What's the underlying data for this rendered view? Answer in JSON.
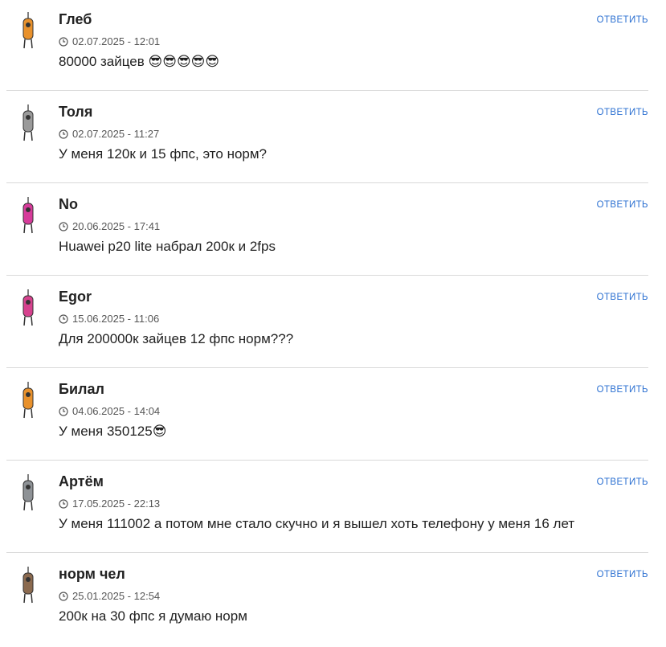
{
  "reply_label": "ОТВЕТИТЬ",
  "comments": [
    {
      "author": "Глеб",
      "date": "02.07.2025 - 12:01",
      "text": "80000 зайцев 😎😎😎😎😎",
      "avatar_color": "#e8912c"
    },
    {
      "author": "Толя",
      "date": "02.07.2025 - 11:27",
      "text": "У меня 120к и 15 фпс, это норм?",
      "avatar_color": "#9a9a9a"
    },
    {
      "author": "No",
      "date": "20.06.2025 - 17:41",
      "text": "Huawei p20 lite набрал 200к и 2fps",
      "avatar_color": "#d63b9a"
    },
    {
      "author": "Egor",
      "date": "15.06.2025 - 11:06",
      "text": "Для 200000к зайцев 12 фпс норм???",
      "avatar_color": "#d6428e"
    },
    {
      "author": "Билал",
      "date": "04.06.2025 - 14:04",
      "text": "У меня 350125😎",
      "avatar_color": "#e8912c"
    },
    {
      "author": "Артём",
      "date": "17.05.2025 - 22:13",
      "text": "У меня 111002 а потом мне стало скучно и я вышел хоть телефону у меня 16 лет",
      "avatar_color": "#8e9296"
    },
    {
      "author": "норм чел",
      "date": "25.01.2025 - 12:54",
      "text": "200к на 30 фпс я думаю норм",
      "avatar_color": "#8b6a4f"
    }
  ]
}
